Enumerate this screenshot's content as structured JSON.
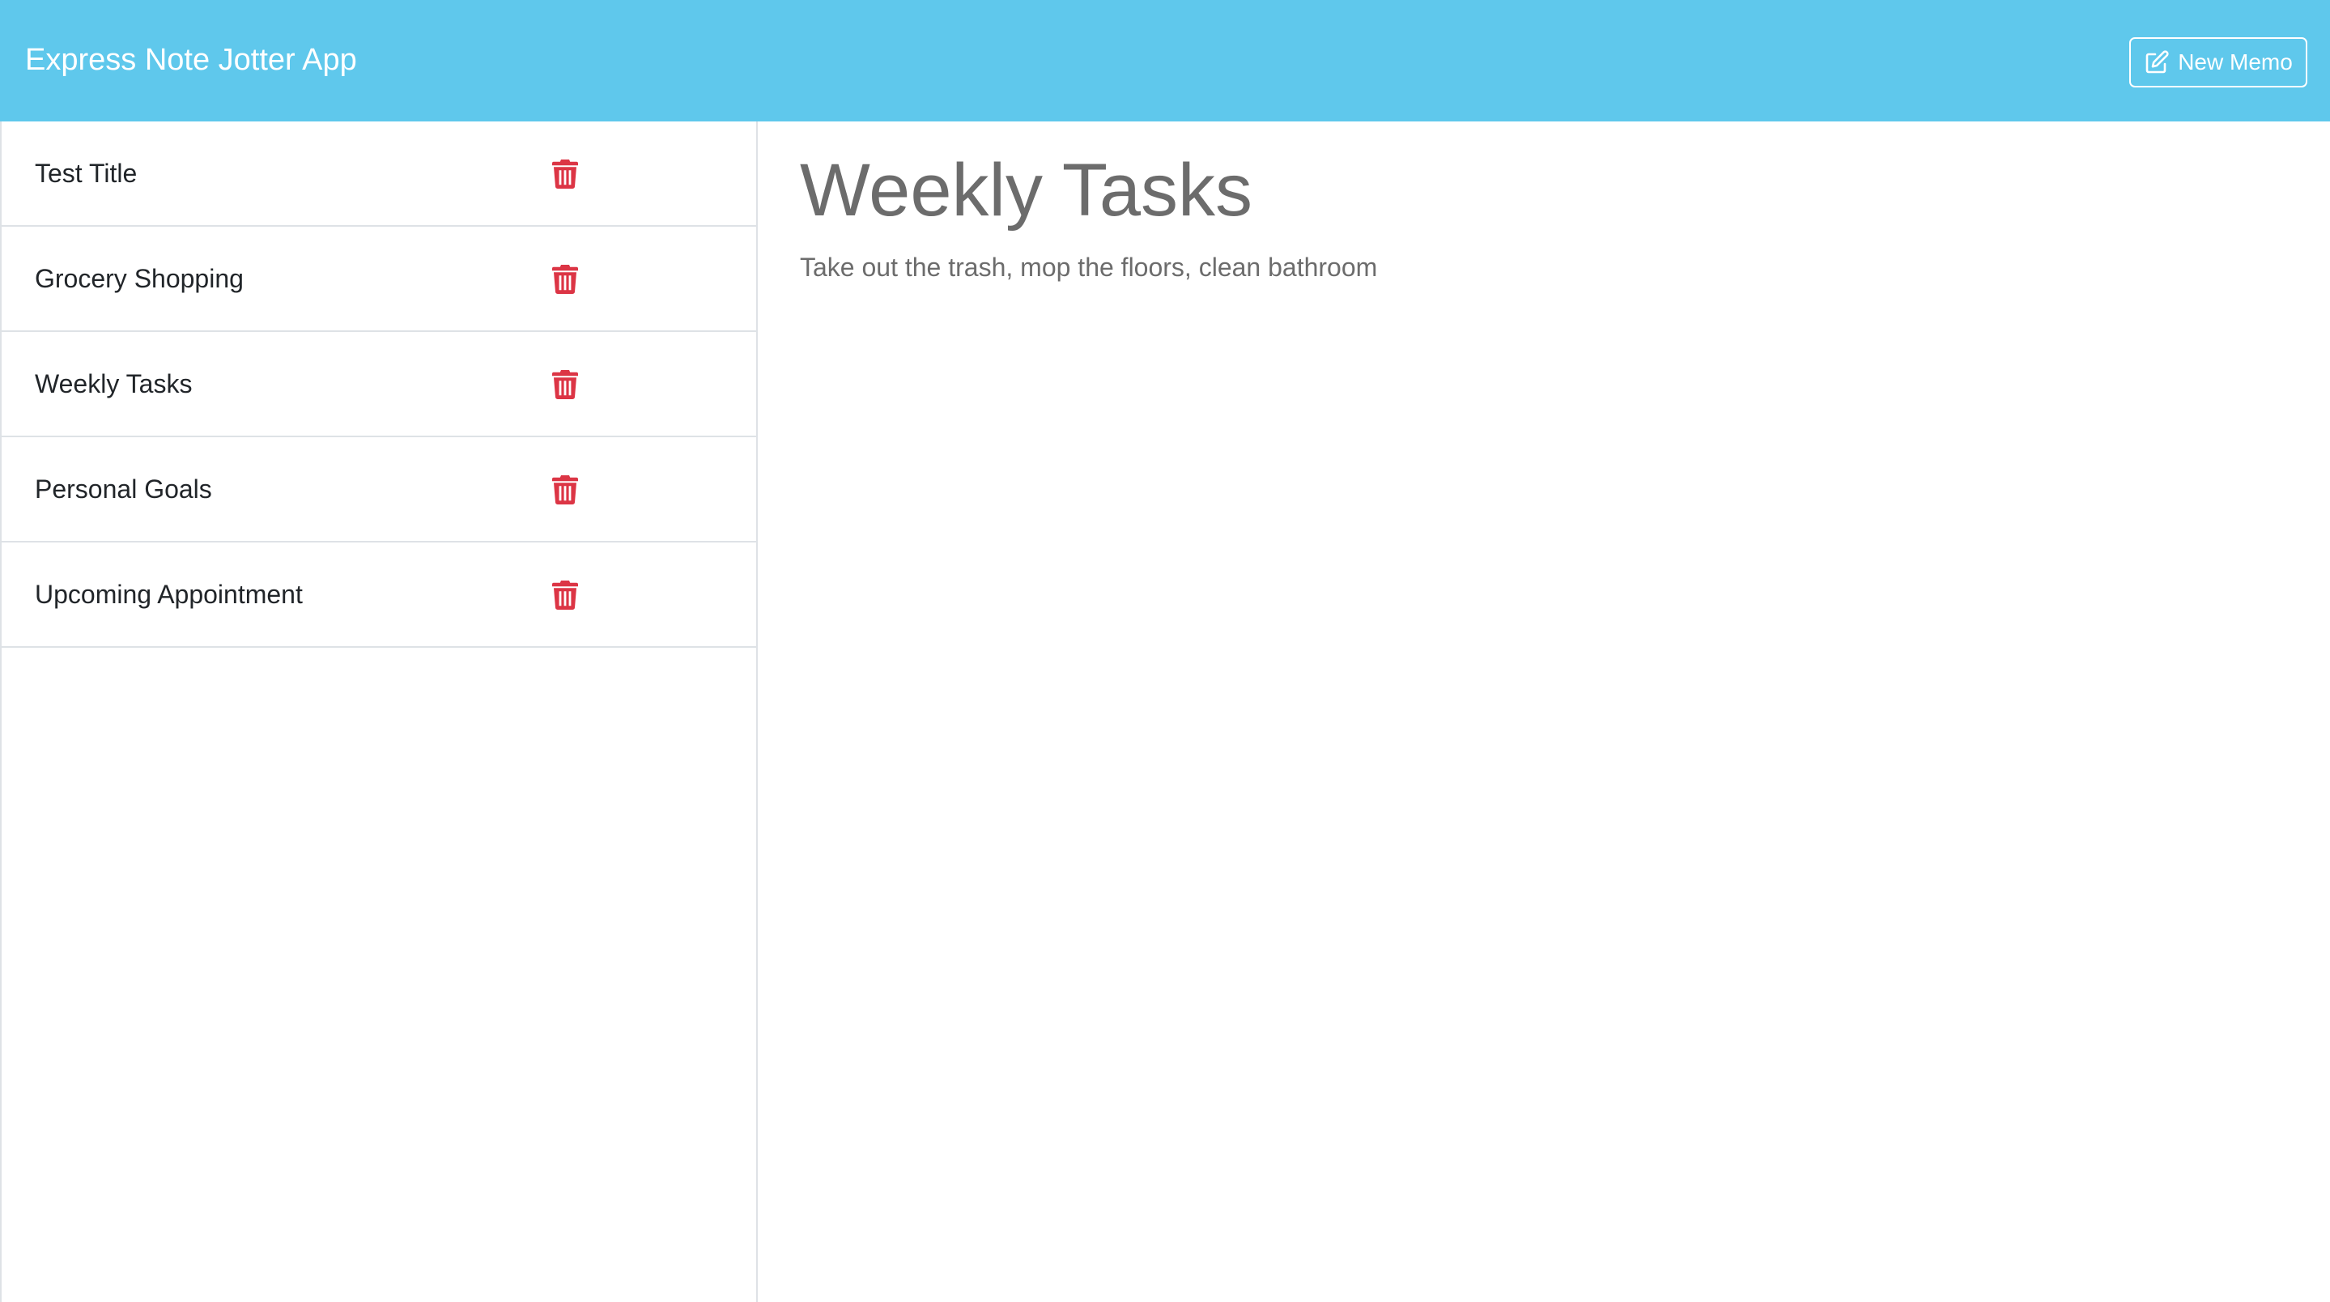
{
  "app": {
    "title": "Express Note Jotter App"
  },
  "toolbar": {
    "new_memo_label": "New Memo",
    "new_memo_icon": "edit-icon"
  },
  "colors": {
    "navbar": "#5fc8ec",
    "trash": "#dc3545",
    "text_muted": "#6c6c6c"
  },
  "notes": [
    {
      "title": "Test Title",
      "icon": "trash-icon"
    },
    {
      "title": "Grocery Shopping",
      "icon": "trash-icon"
    },
    {
      "title": "Weekly Tasks",
      "icon": "trash-icon"
    },
    {
      "title": "Personal Goals",
      "icon": "trash-icon"
    },
    {
      "title": "Upcoming Appointment",
      "icon": "trash-icon"
    }
  ],
  "active_note": {
    "title": "Weekly Tasks",
    "text": "Take out the trash, mop the floors, clean bathroom"
  }
}
